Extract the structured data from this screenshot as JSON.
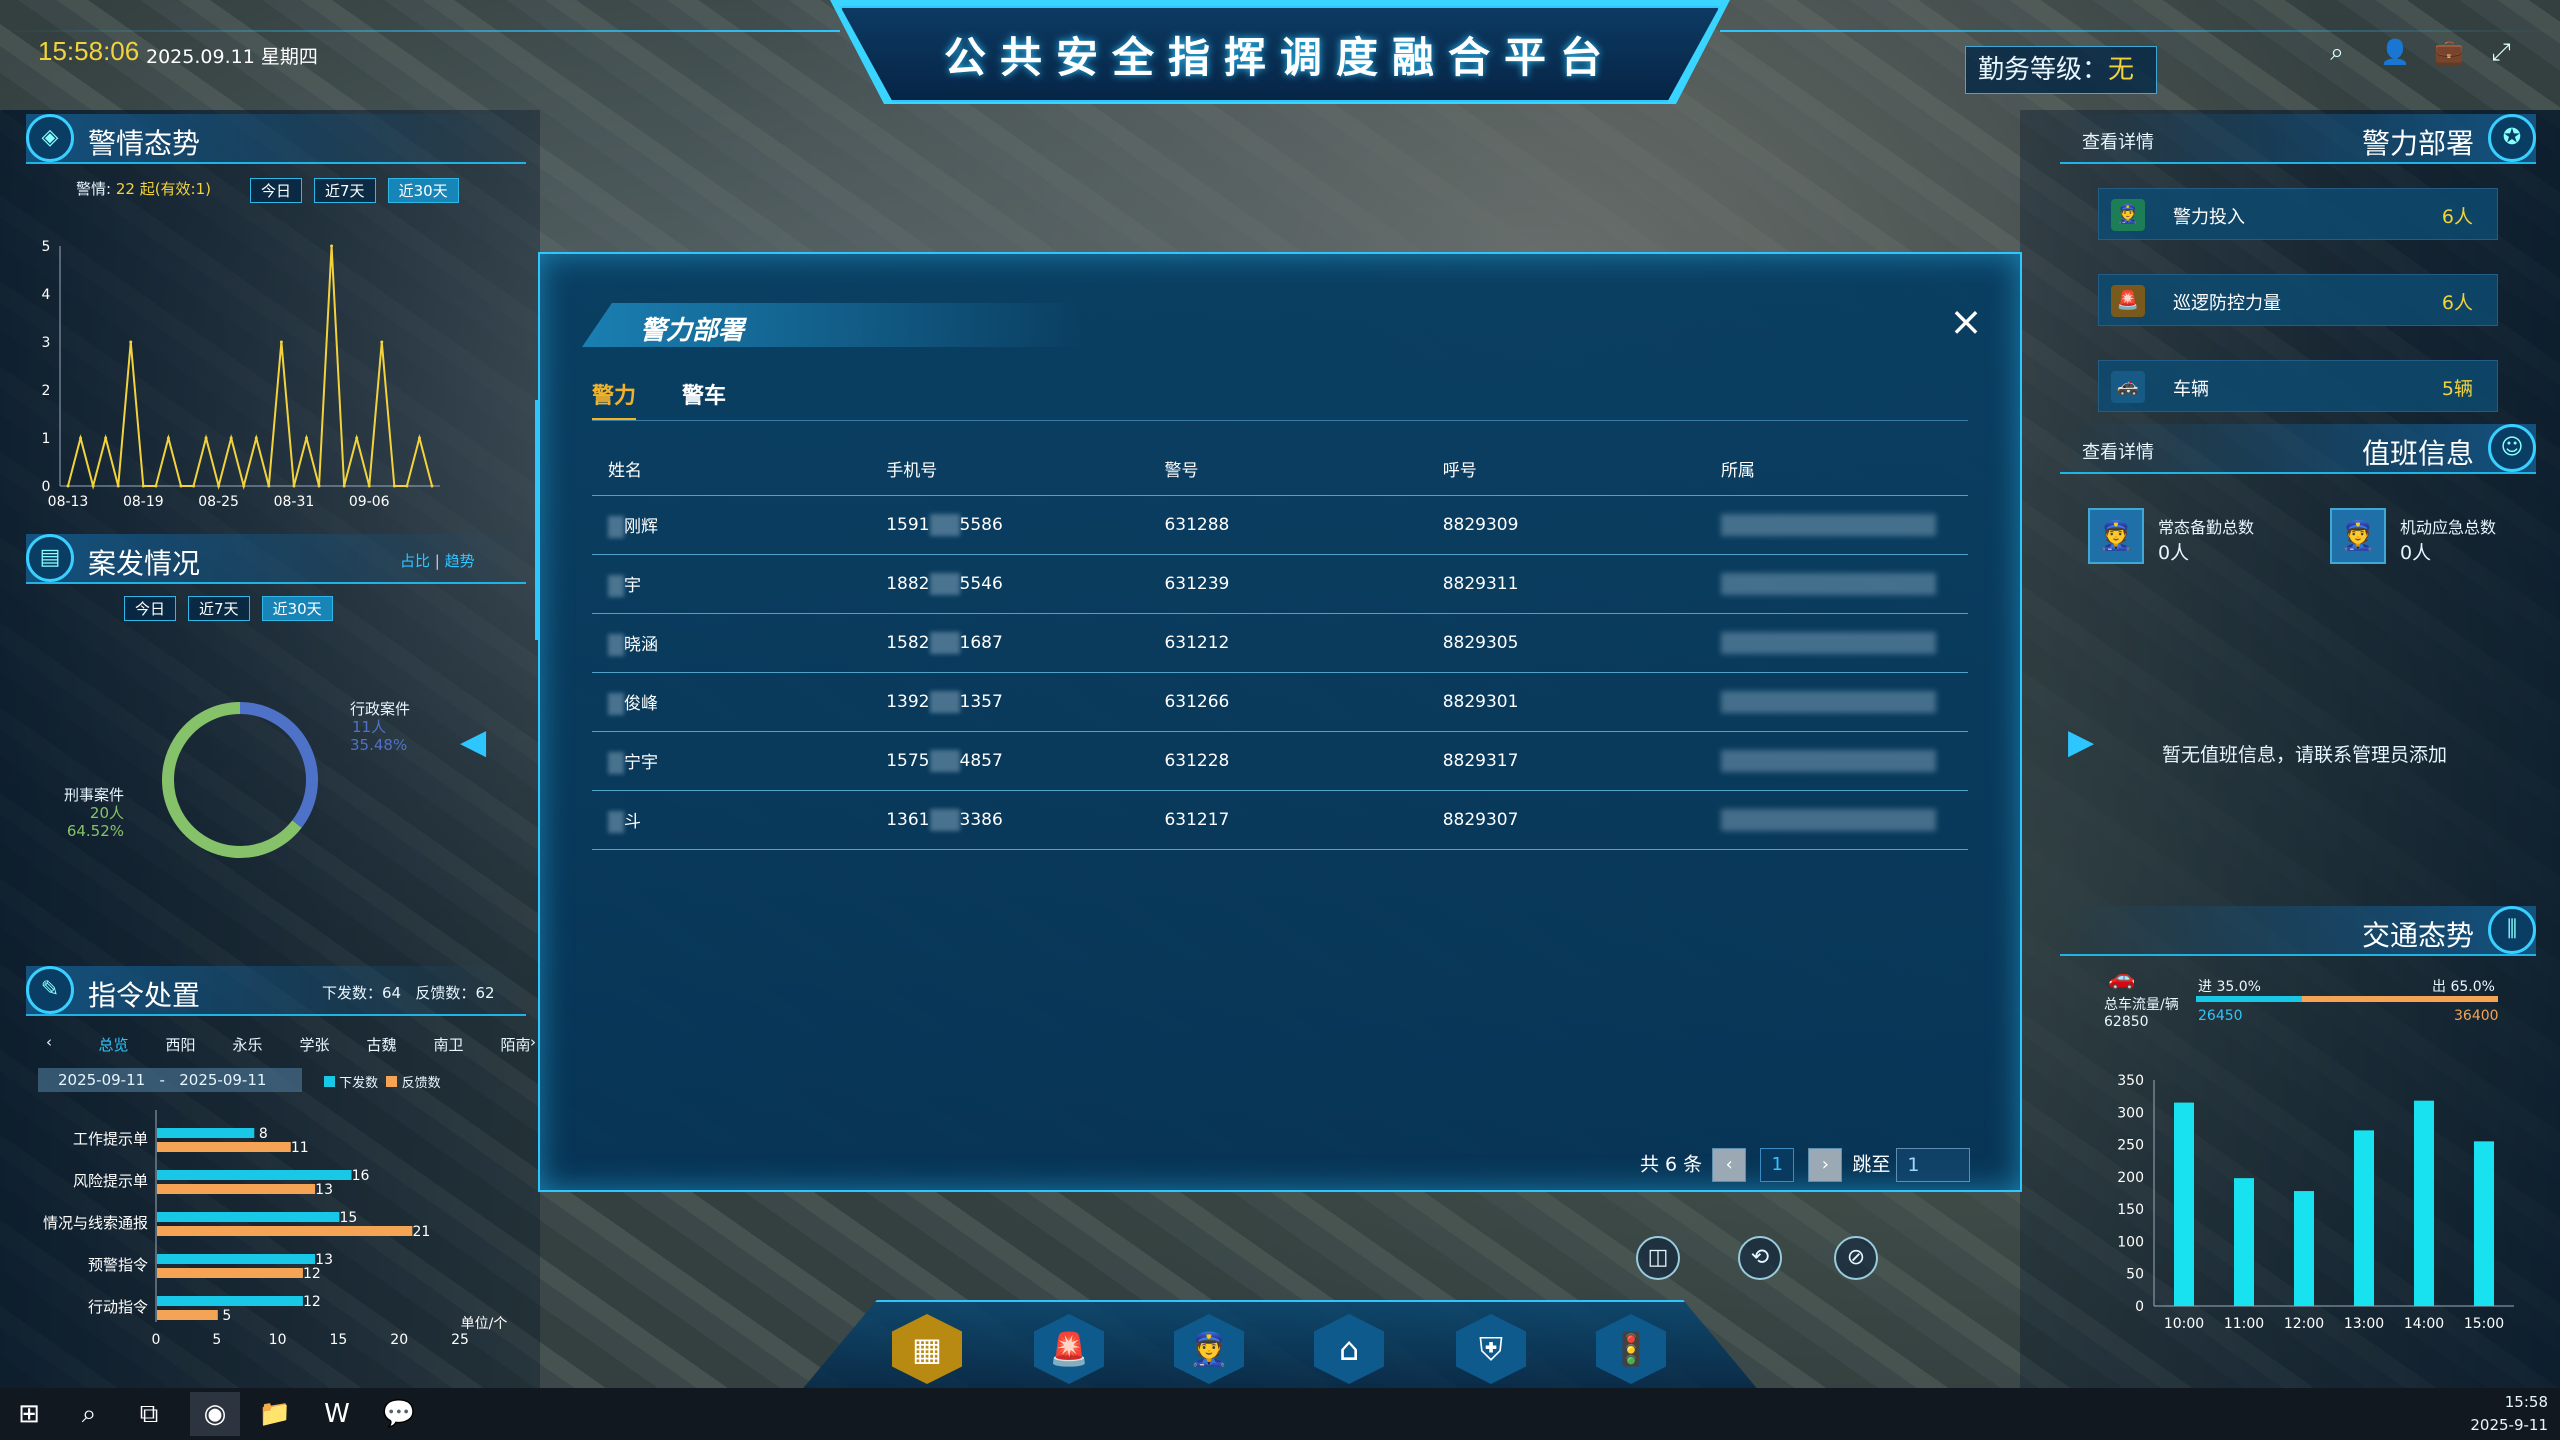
{
  "header": {
    "time": "15:58:06",
    "date": "2025.09.11 星期四",
    "title": "公共安全指挥调度融合平台",
    "duty_label": "勤务等级：",
    "duty_value": "无"
  },
  "alert_panel": {
    "title": "警情态势",
    "summary_label": "警情:",
    "summary_value": "22 起(有效:1)",
    "tabs": [
      "今日",
      "近7天",
      "近30天"
    ],
    "active_tab": "近30天",
    "chart_data": {
      "type": "line",
      "x": [
        "08-13",
        "08-14",
        "08-15",
        "08-16",
        "08-17",
        "08-18",
        "08-19",
        "08-20",
        "08-21",
        "08-22",
        "08-23",
        "08-24",
        "08-25",
        "08-26",
        "08-27",
        "08-28",
        "08-29",
        "08-30",
        "08-31",
        "09-01",
        "09-02",
        "09-03",
        "09-04",
        "09-05",
        "09-06",
        "09-07",
        "09-08",
        "09-09",
        "09-10",
        "09-11"
      ],
      "tick_labels": [
        "08-13",
        "08-19",
        "08-25",
        "08-31",
        "09-06"
      ],
      "values": [
        0,
        1,
        0,
        1,
        0,
        3,
        0,
        0,
        1,
        0,
        0,
        1,
        0,
        1,
        0,
        1,
        0,
        3,
        0,
        1,
        0,
        5,
        0,
        1,
        0,
        3,
        0,
        0,
        1,
        0
      ],
      "ylim": [
        0,
        5
      ],
      "yticks": [
        0,
        1,
        2,
        3,
        4,
        5
      ],
      "color": "#f2d33b"
    }
  },
  "case_panel": {
    "title": "案发情况",
    "links": [
      "占比",
      "趋势"
    ],
    "tabs": [
      "今日",
      "近7天",
      "近30天"
    ],
    "active_tab": "近30天",
    "chart_data": {
      "type": "pie",
      "slices": [
        {
          "name": "行政案件",
          "count": "11人",
          "pct": "35.48%",
          "value": 11,
          "color": "#4f72c9"
        },
        {
          "name": "刑事案件",
          "count": "20人",
          "pct": "64.52%",
          "value": 20,
          "color": "#86c26a"
        }
      ]
    }
  },
  "cmd_panel": {
    "title": "指令处置",
    "issued_label": "下发数：",
    "issued": "64",
    "feedback_label": "反馈数：",
    "feedback": "62",
    "areas": [
      "总览",
      "西阳",
      "永乐",
      "学张",
      "古魏",
      "南卫",
      "陌南"
    ],
    "active_area": "总览",
    "date_from": "2025-09-11",
    "date_sep": "-",
    "date_to": "2025-09-11",
    "legend": [
      "下发数",
      "反馈数"
    ],
    "chart_data": {
      "type": "bar",
      "orientation": "horizontal",
      "categories": [
        "工作提示单",
        "风险提示单",
        "情况与线索通报",
        "预警指令",
        "行动指令"
      ],
      "series": [
        {
          "name": "下发数",
          "values": [
            8,
            16,
            15,
            13,
            12
          ],
          "color": "#19c7e6"
        },
        {
          "name": "反馈数",
          "values": [
            11,
            13,
            21,
            12,
            5
          ],
          "color": "#f4a454"
        }
      ],
      "xlim": [
        0,
        25
      ],
      "xticks": [
        0,
        5,
        10,
        15,
        20,
        25
      ],
      "unit": "单位/个"
    }
  },
  "police_panel": {
    "title": "警力部署",
    "detail": "查看详情",
    "items": [
      {
        "label": "警力投入",
        "value": "6人",
        "icon": "police-officer-icon",
        "color": "#2fb86e"
      },
      {
        "label": "巡逻防控力量",
        "value": "6人",
        "icon": "patrol-light-icon",
        "color": "#c9922b"
      },
      {
        "label": "车辆",
        "value": "5辆",
        "icon": "car-icon",
        "color": "#2a9bd4"
      }
    ]
  },
  "duty_panel": {
    "title": "值班信息",
    "detail": "查看详情",
    "stats": [
      {
        "label": "常态备勤总数",
        "value": "0人"
      },
      {
        "label": "机动应急总数",
        "value": "0人"
      }
    ],
    "empty": "暂无值班信息，请联系管理员添加"
  },
  "traffic_panel": {
    "title": "交通态势",
    "flow_label": "总车流量/辆",
    "flow_total": "62850",
    "in_label": "进 35.0%",
    "in_value": "26450",
    "out_label": "出 65.0%",
    "out_value": "36400",
    "chart_data": {
      "type": "bar",
      "categories": [
        "10:00",
        "11:00",
        "12:00",
        "13:00",
        "14:00",
        "15:00"
      ],
      "values": [
        315,
        198,
        178,
        272,
        318,
        255
      ],
      "ylim": [
        0,
        350
      ],
      "yticks": [
        0,
        50,
        100,
        150,
        200,
        250,
        300,
        350
      ],
      "color": "#19e2f0"
    }
  },
  "modal": {
    "title": "警力部署",
    "tabs": [
      "警力",
      "警车"
    ],
    "active_tab": "警力",
    "columns": [
      "姓名",
      "手机号",
      "警号",
      "呼号",
      "所属"
    ],
    "rows": [
      {
        "name": "刚辉",
        "phone_a": "1591",
        "phone_b": "5586",
        "badge": "631288",
        "call": "8829309"
      },
      {
        "name": "宇",
        "phone_a": "1882",
        "phone_b": "5546",
        "badge": "631239",
        "call": "8829311"
      },
      {
        "name": "晓涵",
        "phone_a": "1582",
        "phone_b": "1687",
        "badge": "631212",
        "call": "8829305"
      },
      {
        "name": "俊峰",
        "phone_a": "1392",
        "phone_b": "1357",
        "badge": "631266",
        "call": "8829301"
      },
      {
        "name": "宁宇",
        "phone_a": "1575",
        "phone_b": "4857",
        "badge": "631228",
        "call": "8829317"
      },
      {
        "name": "斗",
        "phone_a": "1361",
        "phone_b": "3386",
        "badge": "631217",
        "call": "8829307"
      }
    ],
    "pager": {
      "total": "共 6 条",
      "current": "1",
      "jump_label": "跳至",
      "jump_value": "1"
    }
  },
  "taskbar": {
    "time": "15:58",
    "date": "2025-9-11"
  }
}
